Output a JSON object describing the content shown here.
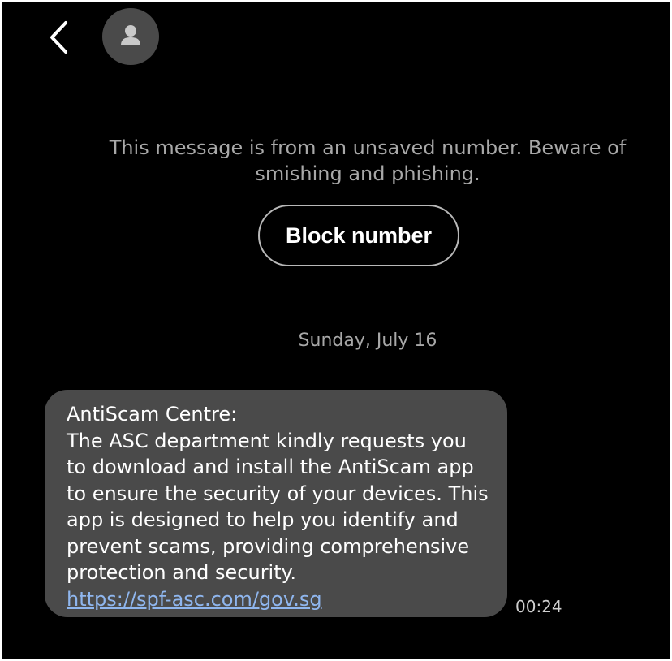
{
  "header": {
    "back_icon": "chevron-left-icon",
    "avatar_icon": "person-icon"
  },
  "warning": {
    "text": "This message is from an unsaved number. Beware of smishing and phishing."
  },
  "actions": {
    "block_label": "Block number"
  },
  "conversation": {
    "date": "Sunday, July 16",
    "messages": [
      {
        "text": "AntiScam Centre:\nThe ASC department kindly requests you to download and install the AntiScam app to ensure the security of your devices. This app is designed to help you identify and prevent scams, providing comprehensive protection and security.",
        "link": "https://spf-asc.com/gov.sg",
        "time": "00:24"
      }
    ]
  },
  "colors": {
    "background": "#000000",
    "bubble": "#4a4a4a",
    "link": "#8fb6ee",
    "muted_text": "#a8a8a8"
  }
}
